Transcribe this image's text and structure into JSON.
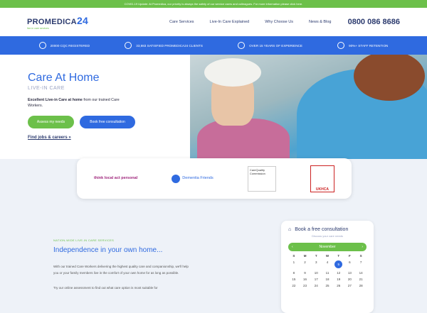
{
  "covid": "COVID-19 Update: At Promedica, our priority is always the safety of our service users and colleagues. For more information please click here.",
  "logo": {
    "name": "PROMEDICA",
    "num": "24",
    "tagline": "live-in care services"
  },
  "nav": [
    "Care Services",
    "Live-In Care Explained",
    "Why Choose Us",
    "News & Blog"
  ],
  "phone": "0800 086 8686",
  "stats": [
    {
      "icon": "cqc-icon",
      "label": "20000 CQC REGISTERED"
    },
    {
      "icon": "smile-icon",
      "label": "33,983 SATISFIED PROMEDICA24 CLIENTS"
    },
    {
      "icon": "hands-icon",
      "label": "OVER 15 YEARS OF EXPERIENCE"
    },
    {
      "icon": "users-icon",
      "label": "90%+ STAFF RETENTION"
    }
  ],
  "hero": {
    "title": "Care At Home",
    "subtitle": "LIVE-IN CARE",
    "text_bold": "Excellent Live-in Care at home",
    "text_rest": " from our trained Care Workers.",
    "btn_assess": "Assess my needs",
    "btn_book": "Book free consultation",
    "jobs": "Find jobs & careers »"
  },
  "partners": [
    {
      "name": "think local act personal"
    },
    {
      "name": "Dementia Friends"
    },
    {
      "name": "CareQuality Commission"
    },
    {
      "name": "UKHCA"
    }
  ],
  "section": {
    "kicker": "NATION-WIDE LIVE-IN CARE SERVICES",
    "title": "Independence in your own home...",
    "para": "With our trained Care Workers delivering the highest quality care and companionship, we'll help you or your family members live in the comfort of your own home for as long as possible.",
    "para2": "Try our online assessment to find out what care option is most suitable for"
  },
  "calendar": {
    "title": "Book a free consultation",
    "subtitle": "Discuss your care needs",
    "month": "November",
    "days": [
      "S",
      "M",
      "T",
      "W",
      "T",
      "F",
      "S"
    ],
    "dates": [
      "1",
      "2",
      "3",
      "4",
      "5",
      "6",
      "7",
      "8",
      "9",
      "10",
      "11",
      "12",
      "13",
      "14",
      "15",
      "16",
      "17",
      "18",
      "19",
      "20",
      "21",
      "22",
      "23",
      "24",
      "25",
      "26",
      "27",
      "28"
    ],
    "selected": "5"
  }
}
